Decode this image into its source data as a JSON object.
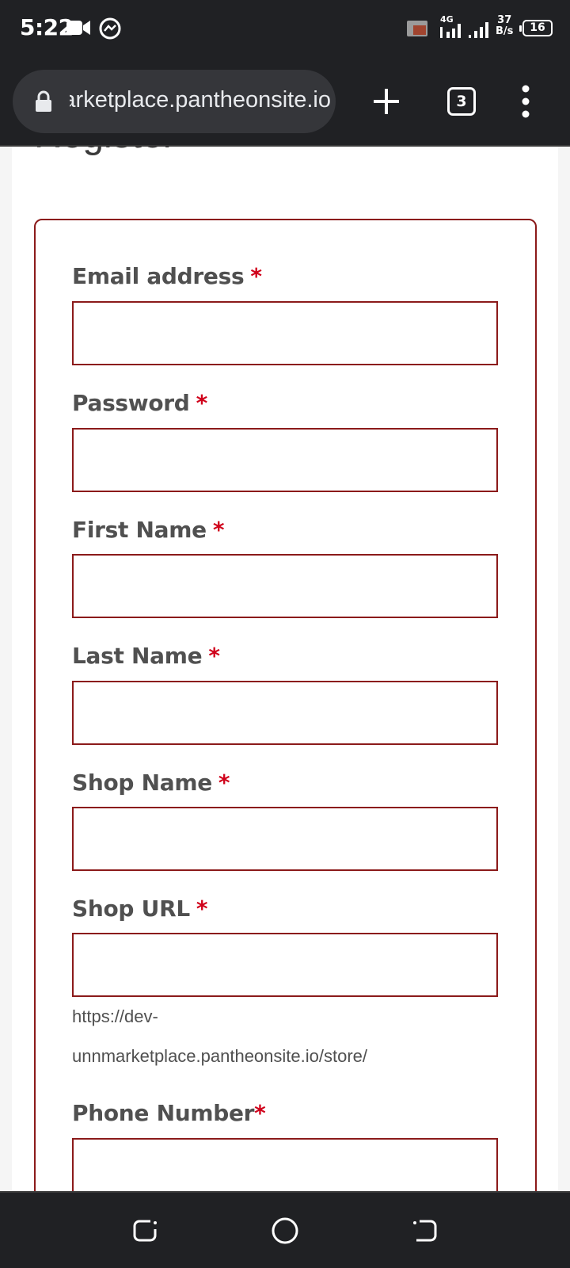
{
  "status_bar": {
    "time": "5:22",
    "network": "4G",
    "speed_value": "37",
    "speed_unit": "B/s",
    "battery": "16",
    "icons": [
      "video-camera-icon",
      "messenger-icon",
      "cast-icon",
      "signal-icon",
      "signal-icon",
      "battery-icon"
    ]
  },
  "browser": {
    "url": "dev-unnmarketplace.pantheonsite.io",
    "tab_count": "3",
    "icons": [
      "lock-icon",
      "plus-icon",
      "more-vert-icon"
    ]
  },
  "page": {
    "title": "Register",
    "required_marker": "*",
    "fields": [
      {
        "label": "Email address",
        "value": ""
      },
      {
        "label": "Password",
        "value": ""
      },
      {
        "label": "First Name",
        "value": ""
      },
      {
        "label": "Last Name",
        "value": ""
      },
      {
        "label": "Shop Name",
        "value": ""
      },
      {
        "label": "Shop URL",
        "value": ""
      },
      {
        "label": "Phone Number",
        "value": ""
      }
    ],
    "shop_url_hint_line1": "https://dev-",
    "shop_url_hint_line2": "unnmarketplace.pantheonsite.io/store/"
  },
  "nav": {
    "icons": [
      "recent-apps-icon",
      "home-icon",
      "back-icon"
    ]
  },
  "colors": {
    "accent": "#8b1a1a",
    "required": "#d0021b",
    "chrome_bg": "#202124"
  }
}
